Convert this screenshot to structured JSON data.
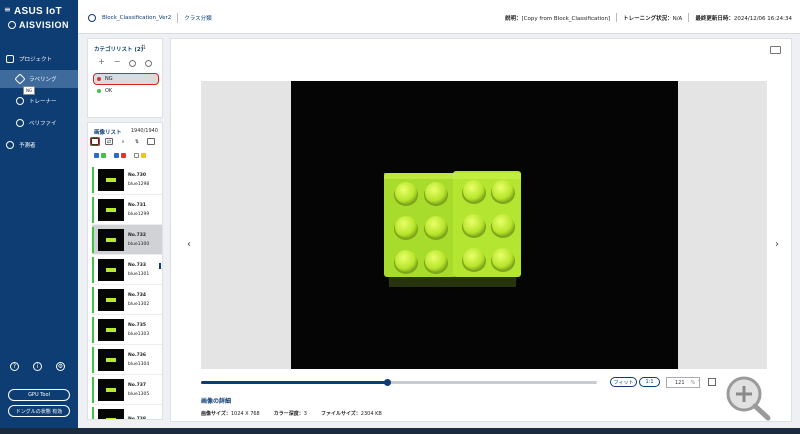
{
  "sidebar": {
    "brand_top": "ASUS IoT",
    "brand_bottom": "AISVISION",
    "nav": [
      "プロジェクト",
      "ラベリング",
      "トレーナー",
      "ベリファイ",
      "予測者"
    ],
    "active_index": 1,
    "gpu_button": "GPU Tool",
    "dongle_button": "ドングルの状態 有効"
  },
  "header": {
    "project": "Block_Classification_Ver2",
    "task": "クラス分類",
    "desc_label": "説明：",
    "desc_value": "[Copy from Block_Classification]",
    "train_label": "トレーニング状況：",
    "train_value": "N/A",
    "updated_label": "最終更新日時：",
    "updated_value": "2024/12/06 16:24:34"
  },
  "categories": {
    "title": "カテゴリリスト (2)",
    "items": [
      {
        "label": "NG",
        "color": "#e0342c"
      },
      {
        "label": "OK",
        "color": "#43c243"
      }
    ],
    "tooltip": "NG"
  },
  "image_list": {
    "title": "画像リスト",
    "count": "1940/1940",
    "filter_colors": [
      "#2b6cc4",
      "#e0342c",
      "#f2c21b"
    ],
    "items": [
      {
        "no": "No.730",
        "name": "blue1298"
      },
      {
        "no": "No.731",
        "name": "blue1299"
      },
      {
        "no": "No.732",
        "name": "blue1300"
      },
      {
        "no": "No.733",
        "name": "blue1301"
      },
      {
        "no": "No.734",
        "name": "blue1302"
      },
      {
        "no": "No.735",
        "name": "blue1303"
      },
      {
        "no": "No.736",
        "name": "blue1304"
      },
      {
        "no": "No.737",
        "name": "blue1305"
      },
      {
        "no": "No.738",
        "name": ""
      }
    ],
    "selected_index": 2
  },
  "viewer": {
    "fit_button": "フィット",
    "ratio_button": "1:1",
    "zoom": "121",
    "zoom_unit": "%",
    "slider_position": 0.47,
    "details_title": "画像の詳細",
    "size_label": "画像サイズ：",
    "size_value": "1024 X 768",
    "depth_label": "カラー深度：",
    "depth_value": "3",
    "file_label": "ファイルサイズ：",
    "file_value": "2304 KB"
  }
}
